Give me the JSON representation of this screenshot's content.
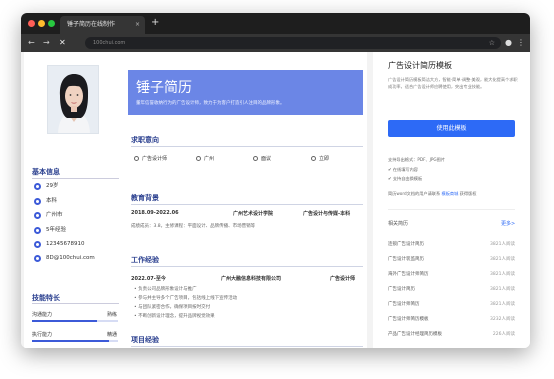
{
  "browser": {
    "tab_title": "锤子简历在线制作",
    "tab_close": "×",
    "new_tab": "+",
    "url": "100chui.com",
    "colors": {
      "red": "#ff5f57",
      "yellow": "#febc2e",
      "green": "#28c840"
    }
  },
  "resume": {
    "name": "锤子简历",
    "subtitle": "董年信誉收纳行为的广告设计师，致力于为客户打造引人注目的品牌形象。",
    "basic_title": "基本信息",
    "info": [
      "29岁",
      "本科",
      "广州市",
      "5年经验",
      "12345678910",
      "8D@100chui.com"
    ],
    "skills_title": "技能特长",
    "skills": [
      {
        "name": "沟通能力",
        "level": "熟练",
        "fill": 0.75
      },
      {
        "name": "执行能力",
        "level": "精通",
        "fill": 0.9
      }
    ],
    "job_title": "求职意向",
    "job": [
      "广告设计师",
      "广州",
      "面议",
      "立即"
    ],
    "edu_title": "教育背景",
    "edu": {
      "date": "2018.09-2022.06",
      "school": "广州艺术设计学院",
      "major": "广告设计与传媒-本科",
      "detail": "成绩成员：3.8，主修课程：平面设计、品牌传播、市场营销等"
    },
    "work_title": "工作经验",
    "work": {
      "date": "2022.07-至今",
      "company": "广州大融信息科技有限公司",
      "role": "广告设计师",
      "bullets": [
        "负责公司品牌形象设计与推广",
        "参与并主导多个广告项目，包括线上线下宣传活动",
        "与团队紧密合作，确保项目按时交付",
        "不断创新设计理念，提升品牌视觉效果"
      ]
    },
    "project_title": "项目经验"
  },
  "panel": {
    "title": "广告设计简历模板",
    "desc": "广告设计简历模板简洁大方，智能·简单·调整·美观，能大化提高个求职成功率，适合广告设计师应聘使用，突出专业技能。",
    "button": "使用此模板",
    "export": "支持导出格式：PDF、JPG图片",
    "features": [
      "✔ 在线填写内容",
      "✔ 支持自由换模板"
    ],
    "copyright_pre": "简历word文档的用户请联系",
    "copyright_link": "模板商城",
    "copyright_post": "获得版权",
    "related_title": "相关简历",
    "related_more": "更多>",
    "related": [
      {
        "name": "连锁广告设计简历",
        "views": "3821人阅读"
      },
      {
        "name": "广告设计装监简历",
        "views": "3821人阅读"
      },
      {
        "name": "海外广告设计师简历",
        "views": "3821人阅读"
      },
      {
        "name": "广告设计简历",
        "views": "3821人阅读"
      },
      {
        "name": "广告设计师简历",
        "views": "3821人阅读"
      },
      {
        "name": "广告设计师简历模板",
        "views": "3232人阅读"
      },
      {
        "name": "产品广告设计经理简历模板",
        "views": "226人阅读"
      }
    ]
  }
}
